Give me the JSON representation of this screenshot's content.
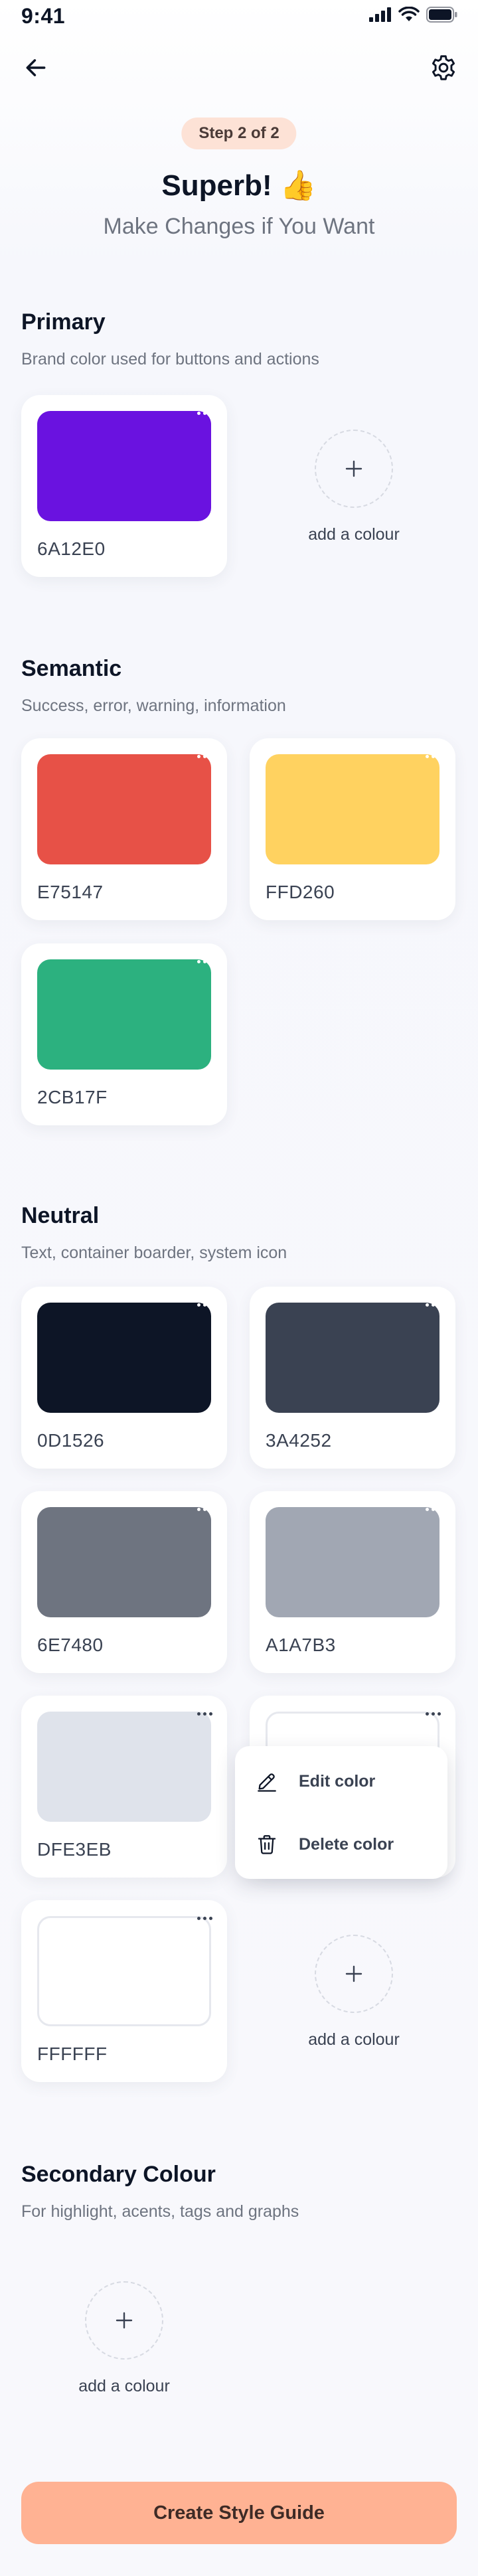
{
  "status_bar": {
    "time": "9:41"
  },
  "header": {
    "step": "Step 2 of 2",
    "title": "Superb! 👍",
    "subtitle": "Make Changes if You Want"
  },
  "add_label": "add a colour",
  "sections": {
    "primary": {
      "title": "Primary",
      "description": "Brand color used for buttons and actions"
    },
    "semantic": {
      "title": "Semantic",
      "description": "Success, error, warning, information"
    },
    "neutral": {
      "title": "Neutral",
      "description": "Text, container boarder, system icon"
    },
    "secondary": {
      "title": "Secondary Colour",
      "description": "For highlight, acents, tags and graphs"
    }
  },
  "colors": {
    "primary": [
      "6A12E0"
    ],
    "semantic": [
      "E75147",
      "FFD260",
      "2CB17F"
    ],
    "neutral": [
      "0D1526",
      "3A4252",
      "6E7480",
      "A1A7B3",
      "DFE3EB",
      "FFFFFF"
    ]
  },
  "context_menu": {
    "edit": "Edit color",
    "delete": "Delete color"
  },
  "cta": {
    "label": "Create Style Guide"
  },
  "icons": {
    "back": "arrow-left-icon",
    "settings": "gear-icon",
    "more": "more-horizontal-icon",
    "add": "plus-icon",
    "edit": "pencil-icon",
    "delete": "trash-icon"
  },
  "theme": {
    "accent": "#FFB293",
    "pill": "#FDE2D6",
    "text": "#0D1526",
    "muted": "#6E7480"
  }
}
